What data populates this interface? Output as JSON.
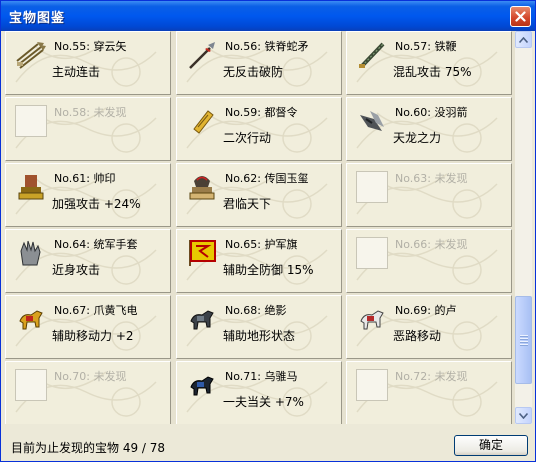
{
  "window": {
    "title": "宝物图鉴"
  },
  "tiles": [
    {
      "number": "No.55:",
      "name": "穿云矢",
      "effect": "主动连击",
      "found": true,
      "icon": "arrows-icon"
    },
    {
      "number": "No.56:",
      "name": "铁脊蛇矛",
      "effect": "无反击破防",
      "found": true,
      "icon": "spear-icon"
    },
    {
      "number": "No.57:",
      "name": "铁鞭",
      "effect": "混乱攻击 75%",
      "found": true,
      "icon": "iron-whip-icon"
    },
    {
      "number": "No.58:",
      "name": "未发现",
      "effect": "",
      "found": false,
      "icon": ""
    },
    {
      "number": "No.59:",
      "name": "都督令",
      "effect": "二次行动",
      "found": true,
      "icon": "command-token-icon"
    },
    {
      "number": "No.60:",
      "name": "没羽箭",
      "effect": "天龙之力",
      "found": true,
      "icon": "featherless-arrow-icon"
    },
    {
      "number": "No.61:",
      "name": "帅印",
      "effect": "加强攻击 +24%",
      "found": true,
      "icon": "seal-icon"
    },
    {
      "number": "No.62:",
      "name": "传国玉玺",
      "effect": "君临天下",
      "found": true,
      "icon": "imperial-jade-seal-icon"
    },
    {
      "number": "No.63:",
      "name": "未发现",
      "effect": "",
      "found": false,
      "icon": ""
    },
    {
      "number": "No.64:",
      "name": "统军手套",
      "effect": "近身攻击",
      "found": true,
      "icon": "gauntlet-icon"
    },
    {
      "number": "No.65:",
      "name": "护军旗",
      "effect": "辅助全防御 15%",
      "found": true,
      "icon": "banner-flag-icon"
    },
    {
      "number": "No.66:",
      "name": "未发现",
      "effect": "",
      "found": false,
      "icon": ""
    },
    {
      "number": "No.67:",
      "name": "爪黄飞电",
      "effect": "辅助移动力 +2",
      "found": true,
      "icon": "yellow-horse-icon"
    },
    {
      "number": "No.68:",
      "name": "绝影",
      "effect": "辅助地形状态",
      "found": true,
      "icon": "dark-horse-icon"
    },
    {
      "number": "No.69:",
      "name": "的卢",
      "effect": "恶路移动",
      "found": true,
      "icon": "white-horse-icon"
    },
    {
      "number": "No.70:",
      "name": "未发现",
      "effect": "",
      "found": false,
      "icon": ""
    },
    {
      "number": "No.71:",
      "name": "乌骓马",
      "effect": "一夫当关 +7%",
      "found": true,
      "icon": "black-horse-icon"
    },
    {
      "number": "No.72:",
      "name": "未发现",
      "effect": "",
      "found": false,
      "icon": ""
    }
  ],
  "status": {
    "text": "目前为止发现的宝物 49 / 78"
  },
  "buttons": {
    "ok": "确定"
  },
  "colors": {
    "titlebar": "#0058ee",
    "tile_bg": "#f1eedc",
    "missing_text": "#b2b0a6"
  }
}
